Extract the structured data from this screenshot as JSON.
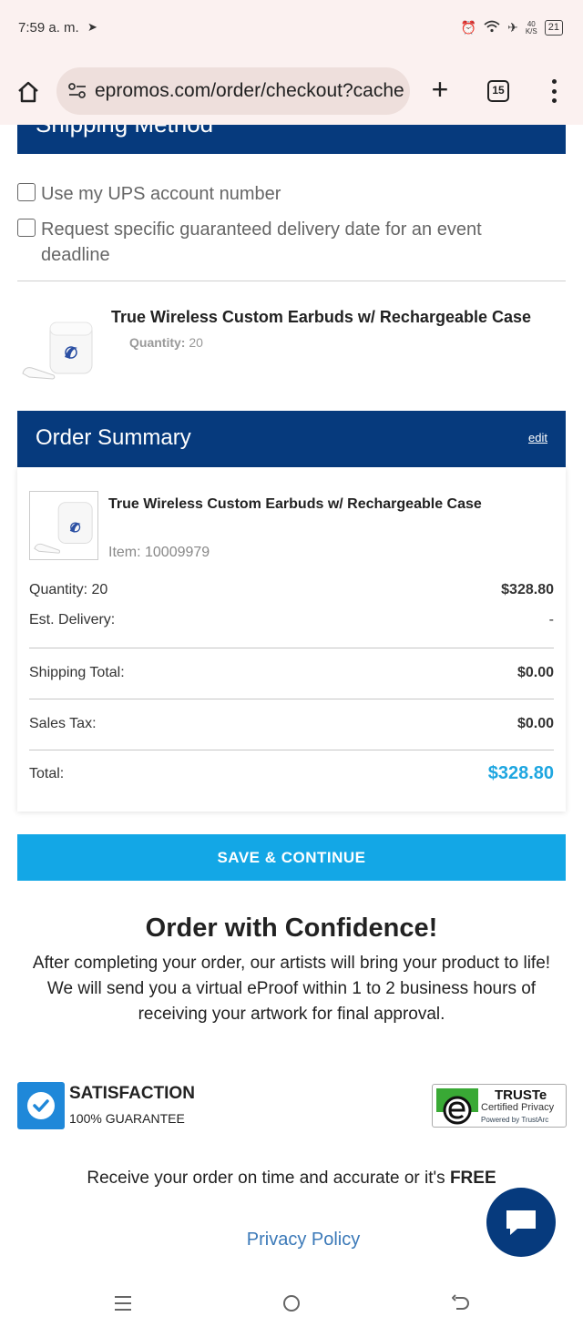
{
  "status_bar": {
    "time": "7:59 a. m.",
    "speed": "40",
    "speed_unit": "K/S",
    "battery": "21"
  },
  "browser": {
    "url": "epromos.com/order/checkout?cache",
    "tab_count": "15"
  },
  "shipping": {
    "section_title": "Shipping Method",
    "options": [
      {
        "label": "Use my UPS account number",
        "checked": false
      },
      {
        "label": "Request specific guaranteed delivery date for an event deadline",
        "checked": false
      }
    ]
  },
  "cart_item": {
    "title": "True Wireless Custom Earbuds w/ Rechargeable Case",
    "quantity_label": "Quantity:",
    "quantity_value": "20"
  },
  "order_summary": {
    "title": "Order Summary",
    "edit_label": "edit",
    "item_title": "True Wireless Custom Earbuds w/ Rechargeable Case",
    "item_number": "Item: 10009979",
    "quantity_label": "Quantity: 20",
    "quantity_price": "$328.80",
    "est_delivery_label": "Est. Delivery:",
    "est_delivery_value": "-",
    "shipping_label": "Shipping Total:",
    "shipping_value": "$0.00",
    "tax_label": "Sales Tax:",
    "tax_value": "$0.00",
    "total_label": "Total:",
    "total_value": "$328.80"
  },
  "cta_label": "SAVE & CONTINUE",
  "confidence": {
    "title": "Order with Confidence!",
    "text": "After completing your order, our artists will bring your product to life! We will send you a virtual eProof within 1 to 2 business hours of receiving your artwork for final approval."
  },
  "guarantee": {
    "title": "SATISFACTION",
    "subtitle": "100% GUARANTEE"
  },
  "truste": {
    "brand": "TRUSTe",
    "line1": "Certified Privacy",
    "line2": "Powered by TrustArc"
  },
  "free_line": {
    "text": "Receive your order on time and accurate or it's",
    "emphasis": "FREE"
  },
  "privacy_link": "Privacy Policy",
  "colors": {
    "brand_navy": "#063a7d",
    "cta_blue": "#13a7e6",
    "total_blue": "#1ea6e0"
  }
}
